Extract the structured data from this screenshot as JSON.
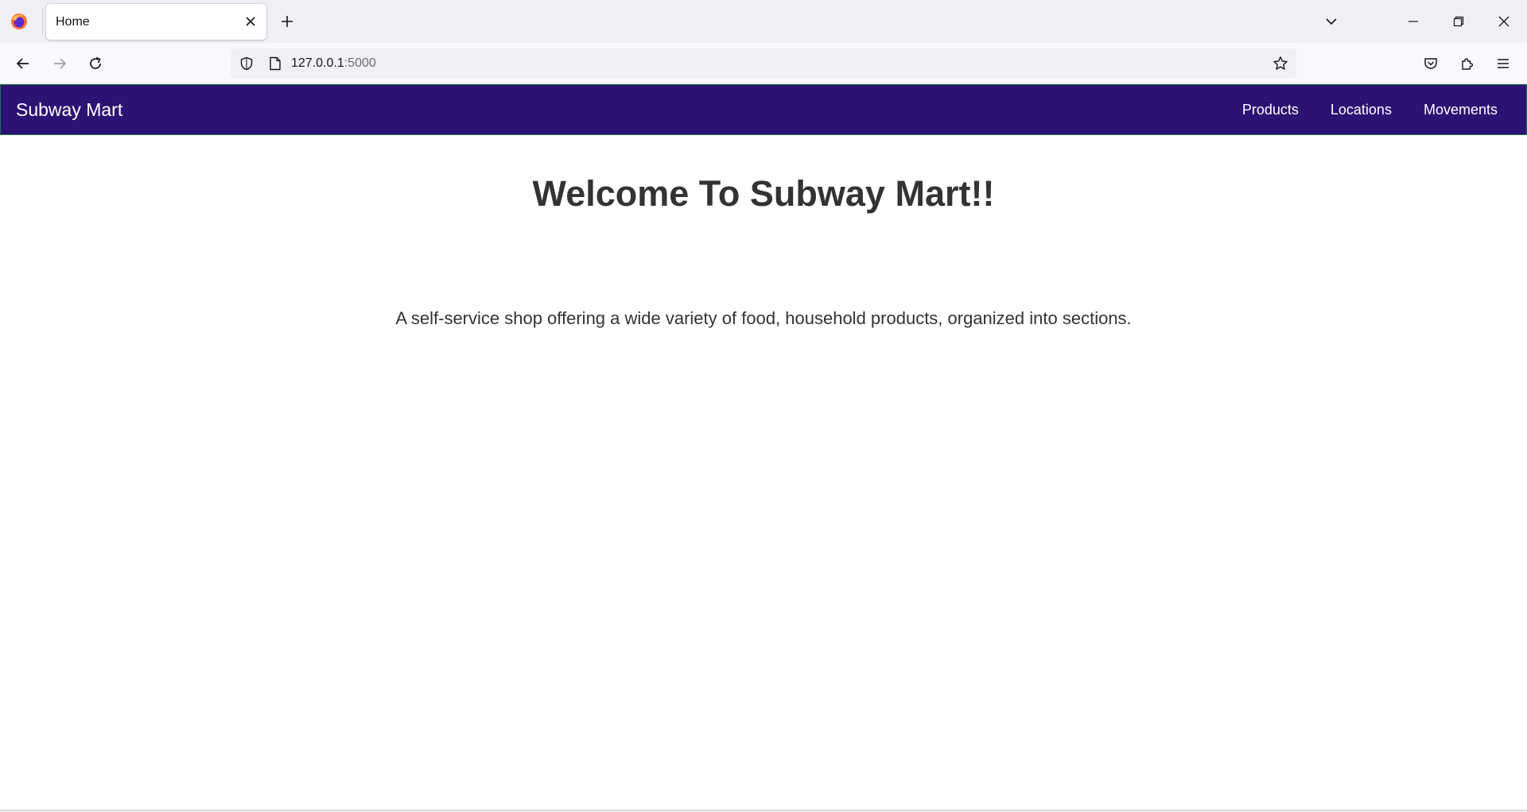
{
  "browser": {
    "tab": {
      "title": "Home"
    },
    "url": {
      "host": "127.0.0.1",
      "port": ":5000"
    },
    "icons": {
      "app": "firefox-icon",
      "tab_close": "close-icon",
      "new_tab": "plus-icon",
      "tab_list": "chevron-down-icon",
      "minimize": "minimize-icon",
      "restore": "restore-icon",
      "close_window": "close-icon",
      "back": "arrow-left-icon",
      "forward": "arrow-right-icon",
      "reload": "reload-icon",
      "tracking": "shield-icon",
      "page": "page-icon",
      "bookmark": "star-icon",
      "pocket": "pocket-icon",
      "extensions": "puzzle-icon",
      "menu": "hamburger-icon"
    }
  },
  "navbar": {
    "brand": "Subway Mart",
    "links": [
      {
        "label": "Products"
      },
      {
        "label": "Locations"
      },
      {
        "label": "Movements"
      }
    ],
    "background": "#2c1273"
  },
  "main": {
    "heading": "Welcome To Subway Mart!!",
    "tagline": "A self-service shop offering a wide variety of food, household products, organized into sections."
  }
}
